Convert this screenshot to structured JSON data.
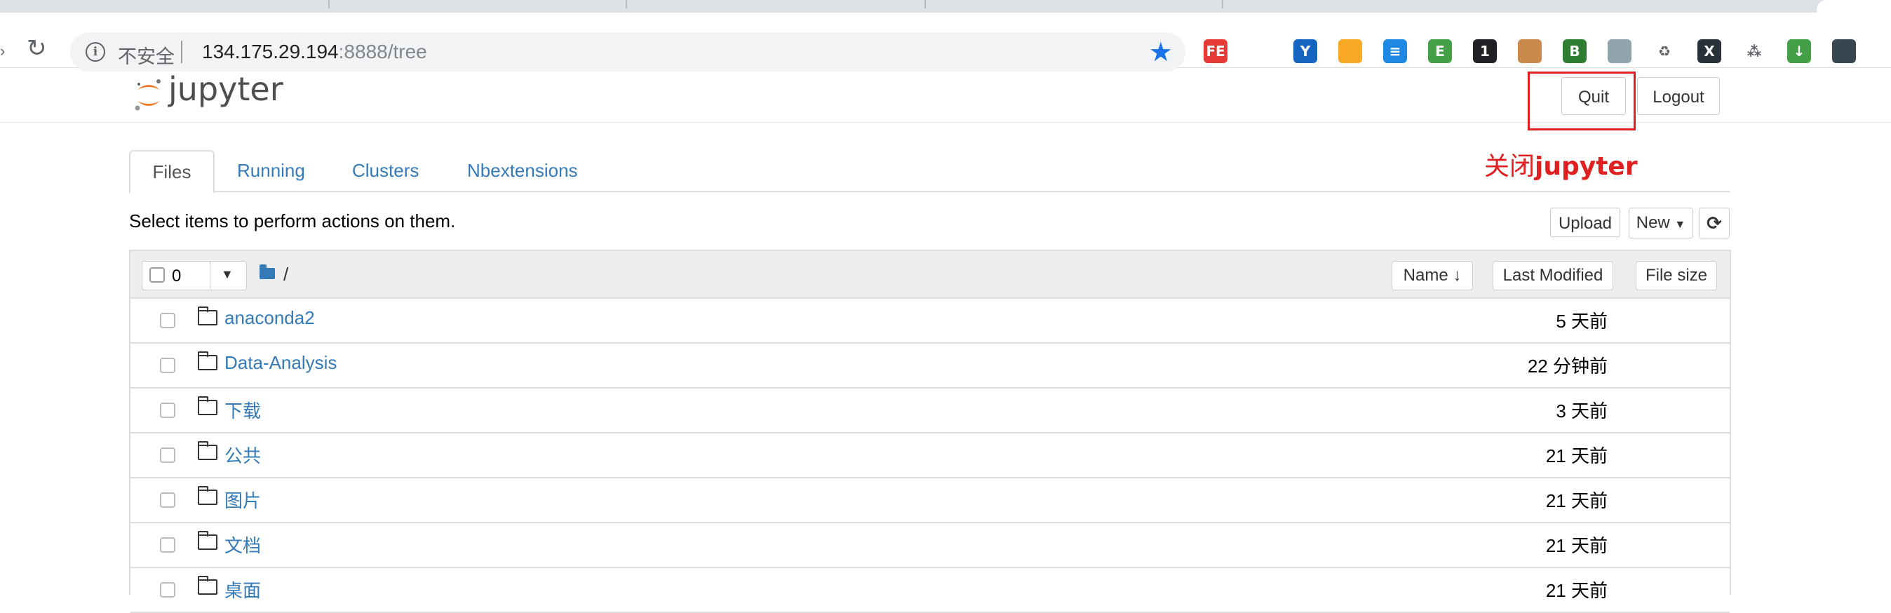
{
  "browser": {
    "security_label": "不安全",
    "url_host": "134.175.29.194",
    "url_rest": ":8888/tree",
    "extensions": [
      {
        "icon": "fe-helper-icon",
        "label": "FE",
        "color": "#e53935"
      },
      {
        "icon": "bookmark-outline-icon",
        "label": "",
        "color": "#ffffff"
      },
      {
        "icon": "vue-devtools-icon",
        "label": "Y",
        "color": "#1565c0"
      },
      {
        "icon": "popcorn-icon",
        "label": "",
        "color": "#f9a825"
      },
      {
        "icon": "stack-icon",
        "label": "≡",
        "color": "#1e88e5"
      },
      {
        "icon": "evernote-icon",
        "label": "E",
        "color": "#43a047"
      },
      {
        "icon": "notification-icon",
        "label": "1",
        "color": "#202124"
      },
      {
        "icon": "cookie-icon",
        "label": "",
        "color": "#c8894a"
      },
      {
        "icon": "green-b-icon",
        "label": "B",
        "color": "#2e7d32"
      },
      {
        "icon": "circle-ext-icon",
        "label": "",
        "color": "#90a4ae"
      },
      {
        "icon": "recycle-icon",
        "label": "♻",
        "color": "#ffffff"
      },
      {
        "icon": "x-ext-icon",
        "label": "X",
        "color": "#263238"
      },
      {
        "icon": "tree-ext-icon",
        "label": "⁂",
        "color": "#ffffff"
      },
      {
        "icon": "download-ext-icon",
        "label": "↓",
        "color": "#43a047"
      },
      {
        "icon": "profile-avatar-icon",
        "label": "",
        "color": "#37474f"
      }
    ]
  },
  "header": {
    "logo_text": "jupyter",
    "quit_label": "Quit",
    "logout_label": "Logout",
    "annotation_cn": "关闭",
    "annotation_bold": "jupyter",
    "annotation_color": "#e02020"
  },
  "tabs": {
    "files": "Files",
    "running": "Running",
    "clusters": "Clusters",
    "nbextensions": "Nbextensions"
  },
  "toolbar": {
    "select_text": "Select items to perform actions on them.",
    "upload_label": "Upload",
    "new_label": "New",
    "refresh_icon": "refresh-icon"
  },
  "list": {
    "selected_count": "0",
    "path": "/",
    "col_name": "Name",
    "col_modified": "Last Modified",
    "col_size": "File size",
    "rows": [
      {
        "name": "anaconda2",
        "modified": "5 天前"
      },
      {
        "name": "Data-Analysis",
        "modified": "22 分钟前"
      },
      {
        "name": "下载",
        "modified": "3 天前"
      },
      {
        "name": "公共",
        "modified": "21 天前"
      },
      {
        "name": "图片",
        "modified": "21 天前"
      },
      {
        "name": "文档",
        "modified": "21 天前"
      },
      {
        "name": "桌面",
        "modified": "21 天前"
      }
    ]
  },
  "colors": {
    "link": "#337ab7",
    "chrome_star": "#1a73e8"
  }
}
